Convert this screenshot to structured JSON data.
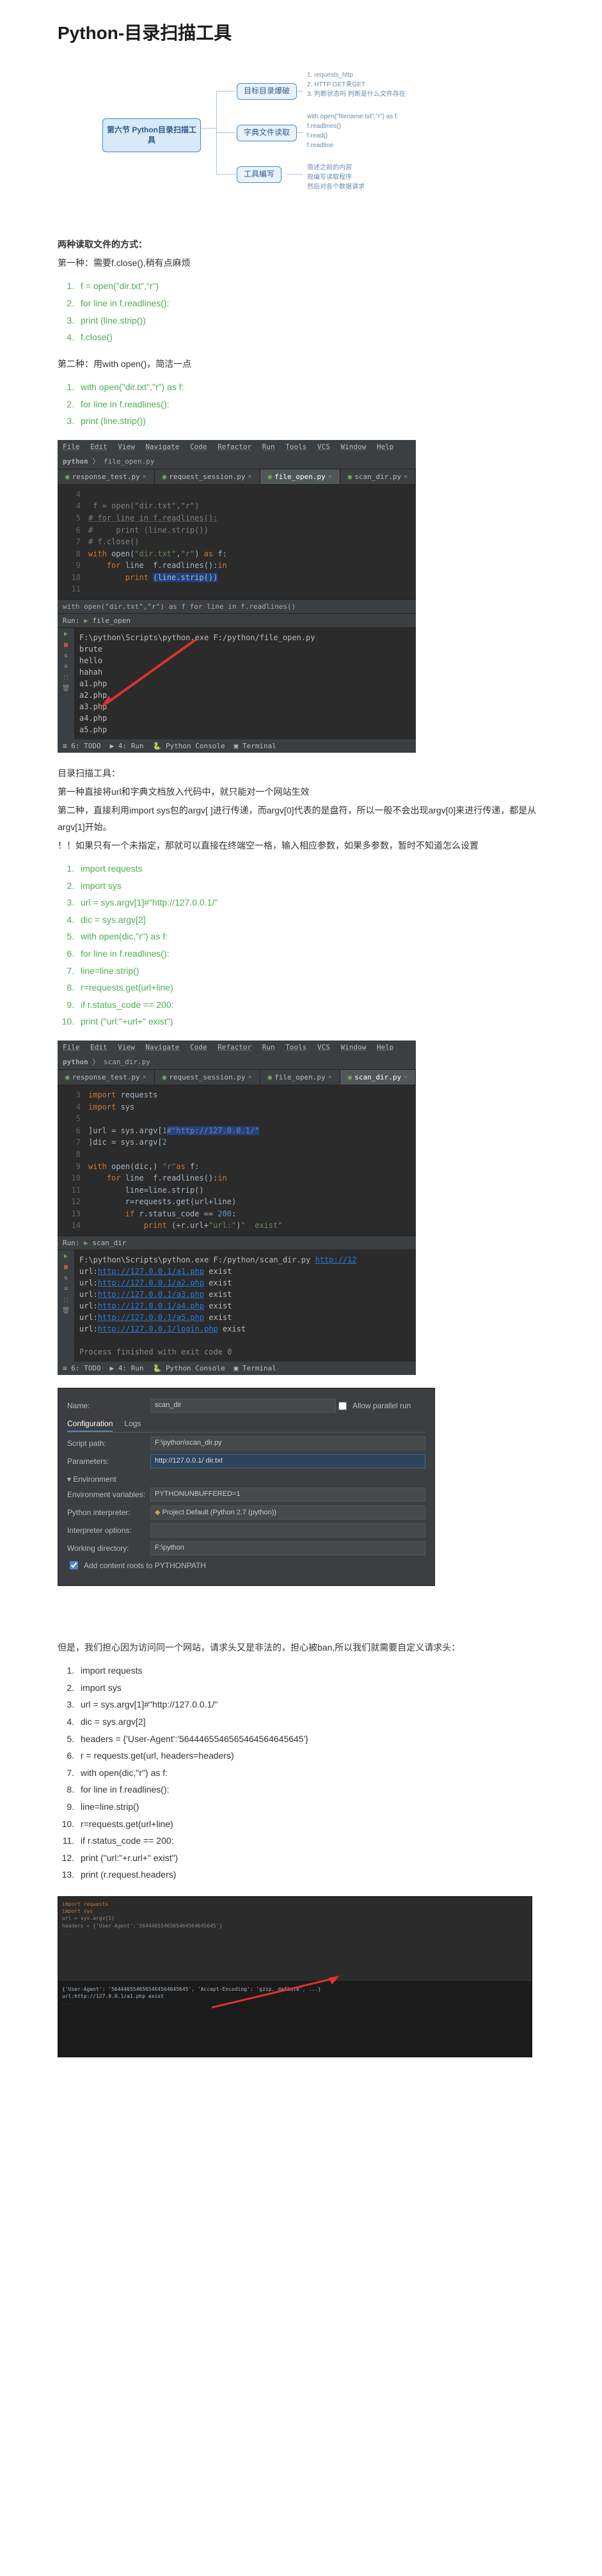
{
  "title": "Python-目录扫描工具",
  "mindmap": {
    "main": "第六节 Python目录扫描工具",
    "b1": "目标目录爆破",
    "b2": "字典文件读取",
    "b3": "工具编写",
    "sub1a": "1. requests_http",
    "sub1b": "2. HTTP GET来GET",
    "sub1c": "3. 判断状态吗 判断是什么文件存在",
    "sub2a": "with open(\"filename.txt\",\"r\") as f:",
    "sub2b": "f.readlines()",
    "sub2c": "f.read()",
    "sub2d": "f.readline",
    "sub3a": "简述之前的内容",
    "sub3b": "现编写读取程序",
    "sub3c": "然后对各个数据请求"
  },
  "text": {
    "two_methods": "两种读取文件的方式：",
    "method1_label": "第一种：需要f.close(),稍有点麻烦",
    "method2_label": "第二种：用with open()，简洁一点",
    "scan_header": "目录扫描工具：",
    "scan_l1": "第一种直接将url和字典文档放入代码中，就只能对一个网站生效",
    "scan_l2": "第二种，直接利用import sys包的argv[ ]进行传递，而argv[0]代表的是盘符，所以一般不会出现argv[0]来进行传递，都是从argv[1]开始。",
    "scan_l3": "！！如果只有一个未指定，那就可以直接在终端空一格，输入相应参数，如果多参数，暂时不知道怎么设置",
    "but_paragraph": "但是，我们担心因为访问同一个网站，请求头又是非法的，担心被ban,所以我们就需要自定义请求头："
  },
  "list1": [
    "f = open(\"dir.txt\",\"r\")",
    "for line in f.readlines():",
    "print (line.strip())",
    "f.close()"
  ],
  "list2": [
    "with open(\"dir.txt\",\"r\") as f:",
    "for line in f.readlines():",
    "print (line.strip())"
  ],
  "list3": [
    "import requests",
    "import sys",
    "url = sys.argv[1]#\"http://127.0.0.1/\"",
    "dic = sys.argv[2]",
    "with open(dic,\"r\") as f:",
    "for line in f.readlines():",
    "line=line.strip()",
    "r=requests.get(url+line)",
    "if r.status_code == 200:",
    "    print (\"url:\"+url+\" exist\")"
  ],
  "list4": [
    "import requests",
    "import sys",
    "url = sys.argv[1]#\"http://127.0.0.1/\"",
    "dic = sys.argv[2]",
    "headers = {'User-Agent':'5644465546565464564645645'}",
    "r = requests.get(url, headers=headers)",
    "with open(dic,\"r\") as f:",
    "for line in f.readlines():",
    "line=line.strip()",
    "r=requests.get(url+line)",
    "if r.status_code == 200:",
    "print (\"url:\"+r.url+\" exist\")",
    "print (r.request.headers)"
  ],
  "ide": {
    "menus": [
      "File",
      "Edit",
      "View",
      "Navigate",
      "Code",
      "Refactor",
      "Run",
      "Tools",
      "VCS",
      "Window",
      "Help"
    ],
    "crumb1": "python",
    "crumb2": "file_open.py",
    "tabs": [
      "response_test.py",
      "request_session.py",
      "file_open.py",
      "scan_dir.py"
    ],
    "status_line": "with open(\"dir.txt\",\"r\") as f   for line in f.readlines()",
    "run_label": "Run:",
    "run_name": "file_open",
    "exec_line": "F:\\python\\Scripts\\python.exe F:/python/file_open.py",
    "output1": [
      "brute",
      "hello",
      "hahah",
      "a1.php",
      "a2.php",
      "a3.php",
      "a4.php",
      "a5.php"
    ],
    "bottom": [
      "6: TODO",
      "4: Run",
      "Python Console",
      "Terminal"
    ]
  },
  "ide_code1": [
    {
      "n": "4",
      "t": "# "
    },
    {
      "n": "4",
      "raw": " f = open(\"dir.txt\",\"r\")",
      "cm": true
    },
    {
      "n": "5",
      "raw": "# for line in f.readlines():",
      "cm": true,
      "u": true
    },
    {
      "n": "6",
      "raw": "#     print (line.strip())",
      "cm": true
    },
    {
      "n": "7",
      "raw": "# f.close()",
      "cm": true
    },
    {
      "n": "8",
      "kw": "with",
      "rest": " open(",
      "str": "\"dir.txt\"",
      "rest2": ",",
      "str2": "\"r\"",
      "rest3": ") ",
      "kw2": "as",
      "rest4": " f:"
    },
    {
      "n": "9",
      "indent": "    ",
      "kw": "for",
      "rest": " line ",
      "kw2": "in",
      "rest2": " f.readlines():"
    },
    {
      "n": "10",
      "indent": "        ",
      "kw": "print",
      "rest": " ",
      "hl": "(line.strip())"
    },
    {
      "n": "11",
      "raw": ""
    }
  ],
  "ide2": {
    "crumb2": "scan_dir.py",
    "active_tab": "scan_dir.py",
    "run_name": "scan_dir",
    "exec_line": "F:\\python\\Scripts\\python.exe F:/python/scan_dir.py http://12",
    "out": [
      "url:http://127.0.0.1/a1.php  exist",
      "url:http://127.0.0.1/a2.php  exist",
      "url:http://127.0.0.1/a3.php  exist",
      "url:http://127.0.0.1/a4.php  exist",
      "url:http://127.0.0.1/a5.php  exist",
      "url:http://127.0.0.1/login.php  exist"
    ],
    "process_end": "Process finished with exit code 0"
  },
  "ide_code2": [
    {
      "n": "3",
      "kw": "import",
      "rest": " requests"
    },
    {
      "n": "4",
      "kw": "import",
      "rest": " sys"
    },
    {
      "n": "5",
      "raw": ""
    },
    {
      "n": "6",
      "raw": "url = sys.argv[",
      "num": "1",
      "rest": "]",
      "cm": "#\"http://127.0.0.1/\"",
      "hlcm": true
    },
    {
      "n": "7",
      "raw": "dic = sys.argv[",
      "num": "2",
      "rest": "]"
    },
    {
      "n": "8",
      "raw": ""
    },
    {
      "n": "9",
      "kw": "with",
      "rest": " open(dic,",
      "str": "\"r\"",
      "rest2": ") ",
      "kw2": "as",
      "rest3": " f:"
    },
    {
      "n": "10",
      "indent": "    ",
      "kw": "for",
      "rest": " line ",
      "kw2": "in",
      "rest2": " f.readlines():"
    },
    {
      "n": "11",
      "indent": "        ",
      "raw": "line=line.strip()"
    },
    {
      "n": "12",
      "indent": "        ",
      "raw": "r=requests.get(url+line)"
    },
    {
      "n": "13",
      "indent": "        ",
      "kw": "if",
      "rest": " r.status_code == ",
      "num": "200",
      "rest2": ":"
    },
    {
      "n": "14",
      "indent": "            ",
      "kw": "print",
      "rest": " (",
      "str": "\"url:\"",
      "rest2": "+r.url+",
      "str2": "\"  exist\"",
      "rest3": ")"
    }
  ],
  "config": {
    "name_label": "Name:",
    "name_value": "scan_dir",
    "allow_parallel": "Allow parallel run",
    "tab_conf": "Configuration",
    "tab_logs": "Logs",
    "script_label": "Script path:",
    "script_value": "F:\\python\\scan_dir.py",
    "params_label": "Parameters:",
    "params_value": "http://127.0.0.1/ dir.txt",
    "env_header": "▾ Environment",
    "envvars_label": "Environment variables:",
    "envvars_value": "PYTHONUNBUFFERED=1",
    "interp_label": "Python interpreter:",
    "interp_value": "Project Default (Python 2.7 (python))",
    "interp_opts_label": "Interpreter options:",
    "wd_label": "Working directory:",
    "wd_value": "F:\\python",
    "add_content": "Add content roots to PYTHONPATH"
  },
  "final": {
    "code_hint1": "import requests",
    "code_hint2": "import sys",
    "code_hint3": "url = sys.argv[1]",
    "code_hint4": "headers = {'User-Agent':'5644465546565464564645645'}",
    "out_hint1": "{'User-Agent': '5644465546565464564645645', 'Accept-Encoding': 'gzip, deflate', ...}",
    "out_hint2": "url:http://127.0.0.1/a1.php  exist"
  }
}
